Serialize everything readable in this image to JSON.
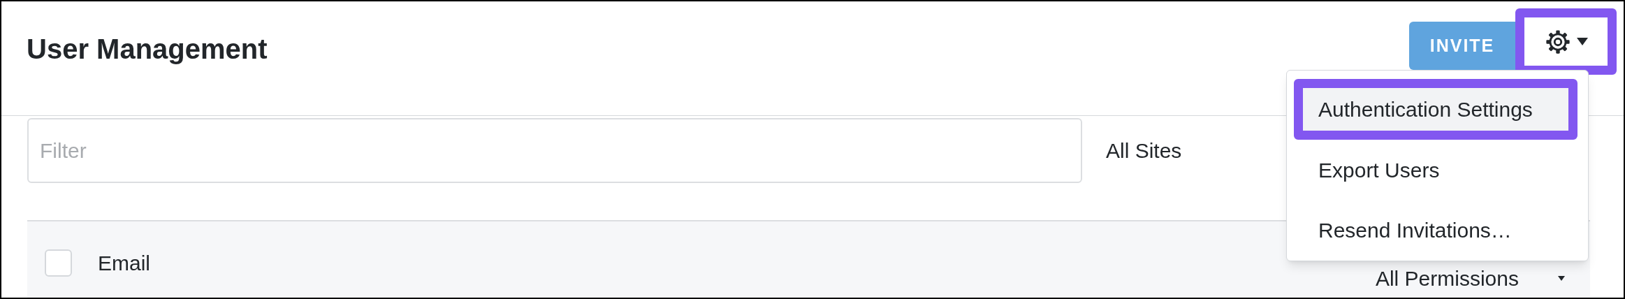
{
  "header": {
    "title": "User Management",
    "invite_button": "INVITE",
    "settings_button": {
      "highlighted": true
    }
  },
  "filter": {
    "placeholder": "Filter"
  },
  "site_select": {
    "value": "All Sites"
  },
  "table": {
    "header": {
      "checked": false,
      "columns": [
        {
          "label": "Email",
          "kind": "text"
        },
        {
          "label": "All Permissions",
          "kind": "dropdown"
        }
      ]
    }
  },
  "menu": {
    "items": [
      {
        "label": "Authentication Settings",
        "selected": true
      },
      {
        "label": "Export Users",
        "selected": false
      },
      {
        "label": "Resend Invitations…",
        "selected": false
      }
    ]
  }
}
